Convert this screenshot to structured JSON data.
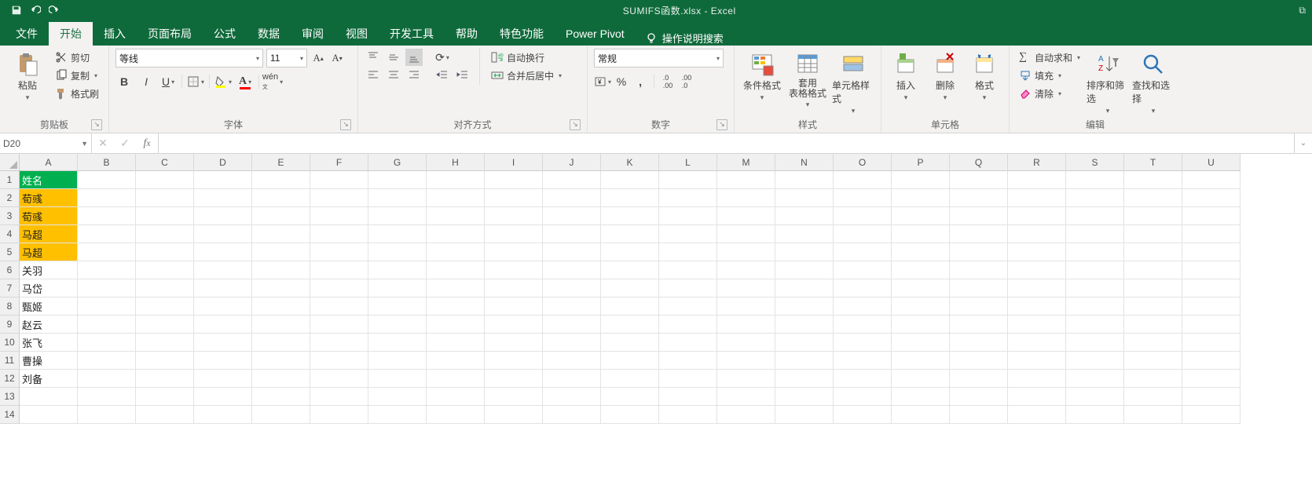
{
  "titlebar": {
    "doc_title": "SUMIFS函数.xlsx  -  Excel",
    "restore_label": "⧉"
  },
  "tabs": {
    "items": [
      "文件",
      "开始",
      "插入",
      "页面布局",
      "公式",
      "数据",
      "审阅",
      "视图",
      "开发工具",
      "帮助",
      "特色功能",
      "Power Pivot"
    ],
    "active_index": 1,
    "tell_me": "操作说明搜索"
  },
  "ribbon": {
    "clipboard": {
      "paste": "粘贴",
      "cut": "剪切",
      "copy": "复制",
      "format_painter": "格式刷",
      "label": "剪贴板"
    },
    "font": {
      "name": "等线",
      "size": "11",
      "label": "字体"
    },
    "alignment": {
      "wrap": "自动换行",
      "merge": "合并后居中",
      "label": "对齐方式"
    },
    "number": {
      "format": "常规",
      "label": "数字"
    },
    "styles": {
      "cond": "条件格式",
      "table": "套用\n表格格式",
      "cell": "单元格样式",
      "label": "样式"
    },
    "cells": {
      "insert": "插入",
      "delete": "删除",
      "format": "格式",
      "label": "单元格"
    },
    "editing": {
      "autosum": "自动求和",
      "fill": "填充",
      "clear": "清除",
      "sort": "排序和筛选",
      "find": "查找和选择",
      "label": "编辑"
    }
  },
  "namebox": "D20",
  "columns": [
    "A",
    "B",
    "C",
    "D",
    "E",
    "F",
    "G",
    "H",
    "I",
    "J",
    "K",
    "L",
    "M",
    "N",
    "O",
    "P",
    "Q",
    "R",
    "S",
    "T",
    "U"
  ],
  "row_count": 14,
  "cells": {
    "A1": {
      "v": "姓名",
      "cls": "hdr"
    },
    "A2": {
      "v": "荀彧",
      "cls": "hl"
    },
    "A3": {
      "v": "荀彧",
      "cls": "hl"
    },
    "A4": {
      "v": "马超",
      "cls": "hl"
    },
    "A5": {
      "v": "马超",
      "cls": "hl"
    },
    "A6": {
      "v": "关羽"
    },
    "A7": {
      "v": "马岱"
    },
    "A8": {
      "v": "甄姬"
    },
    "A9": {
      "v": "赵云"
    },
    "A10": {
      "v": "张飞"
    },
    "A11": {
      "v": "曹操"
    },
    "A12": {
      "v": "刘备"
    }
  }
}
